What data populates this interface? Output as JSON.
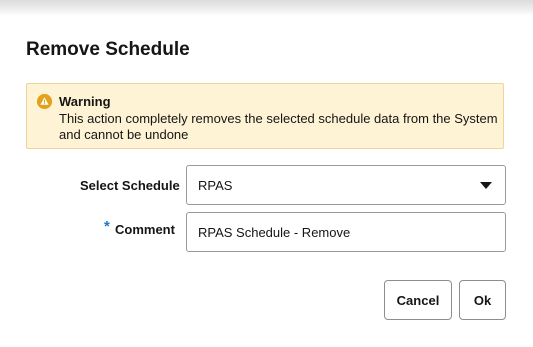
{
  "dialog": {
    "title": "Remove Schedule"
  },
  "warning": {
    "heading": "Warning",
    "message": "This action completely removes the selected schedule data from the System and cannot be undone",
    "icon": "warning-icon",
    "icon_color": "#e3a21a",
    "background": "#fff3d6"
  },
  "form": {
    "select_schedule": {
      "label": "Select Schedule",
      "value": "RPAS"
    },
    "comment": {
      "required_marker": "*",
      "label": "Comment",
      "value": "RPAS Schedule - Remove"
    }
  },
  "buttons": {
    "cancel_label": "Cancel",
    "ok_label": "Ok"
  }
}
